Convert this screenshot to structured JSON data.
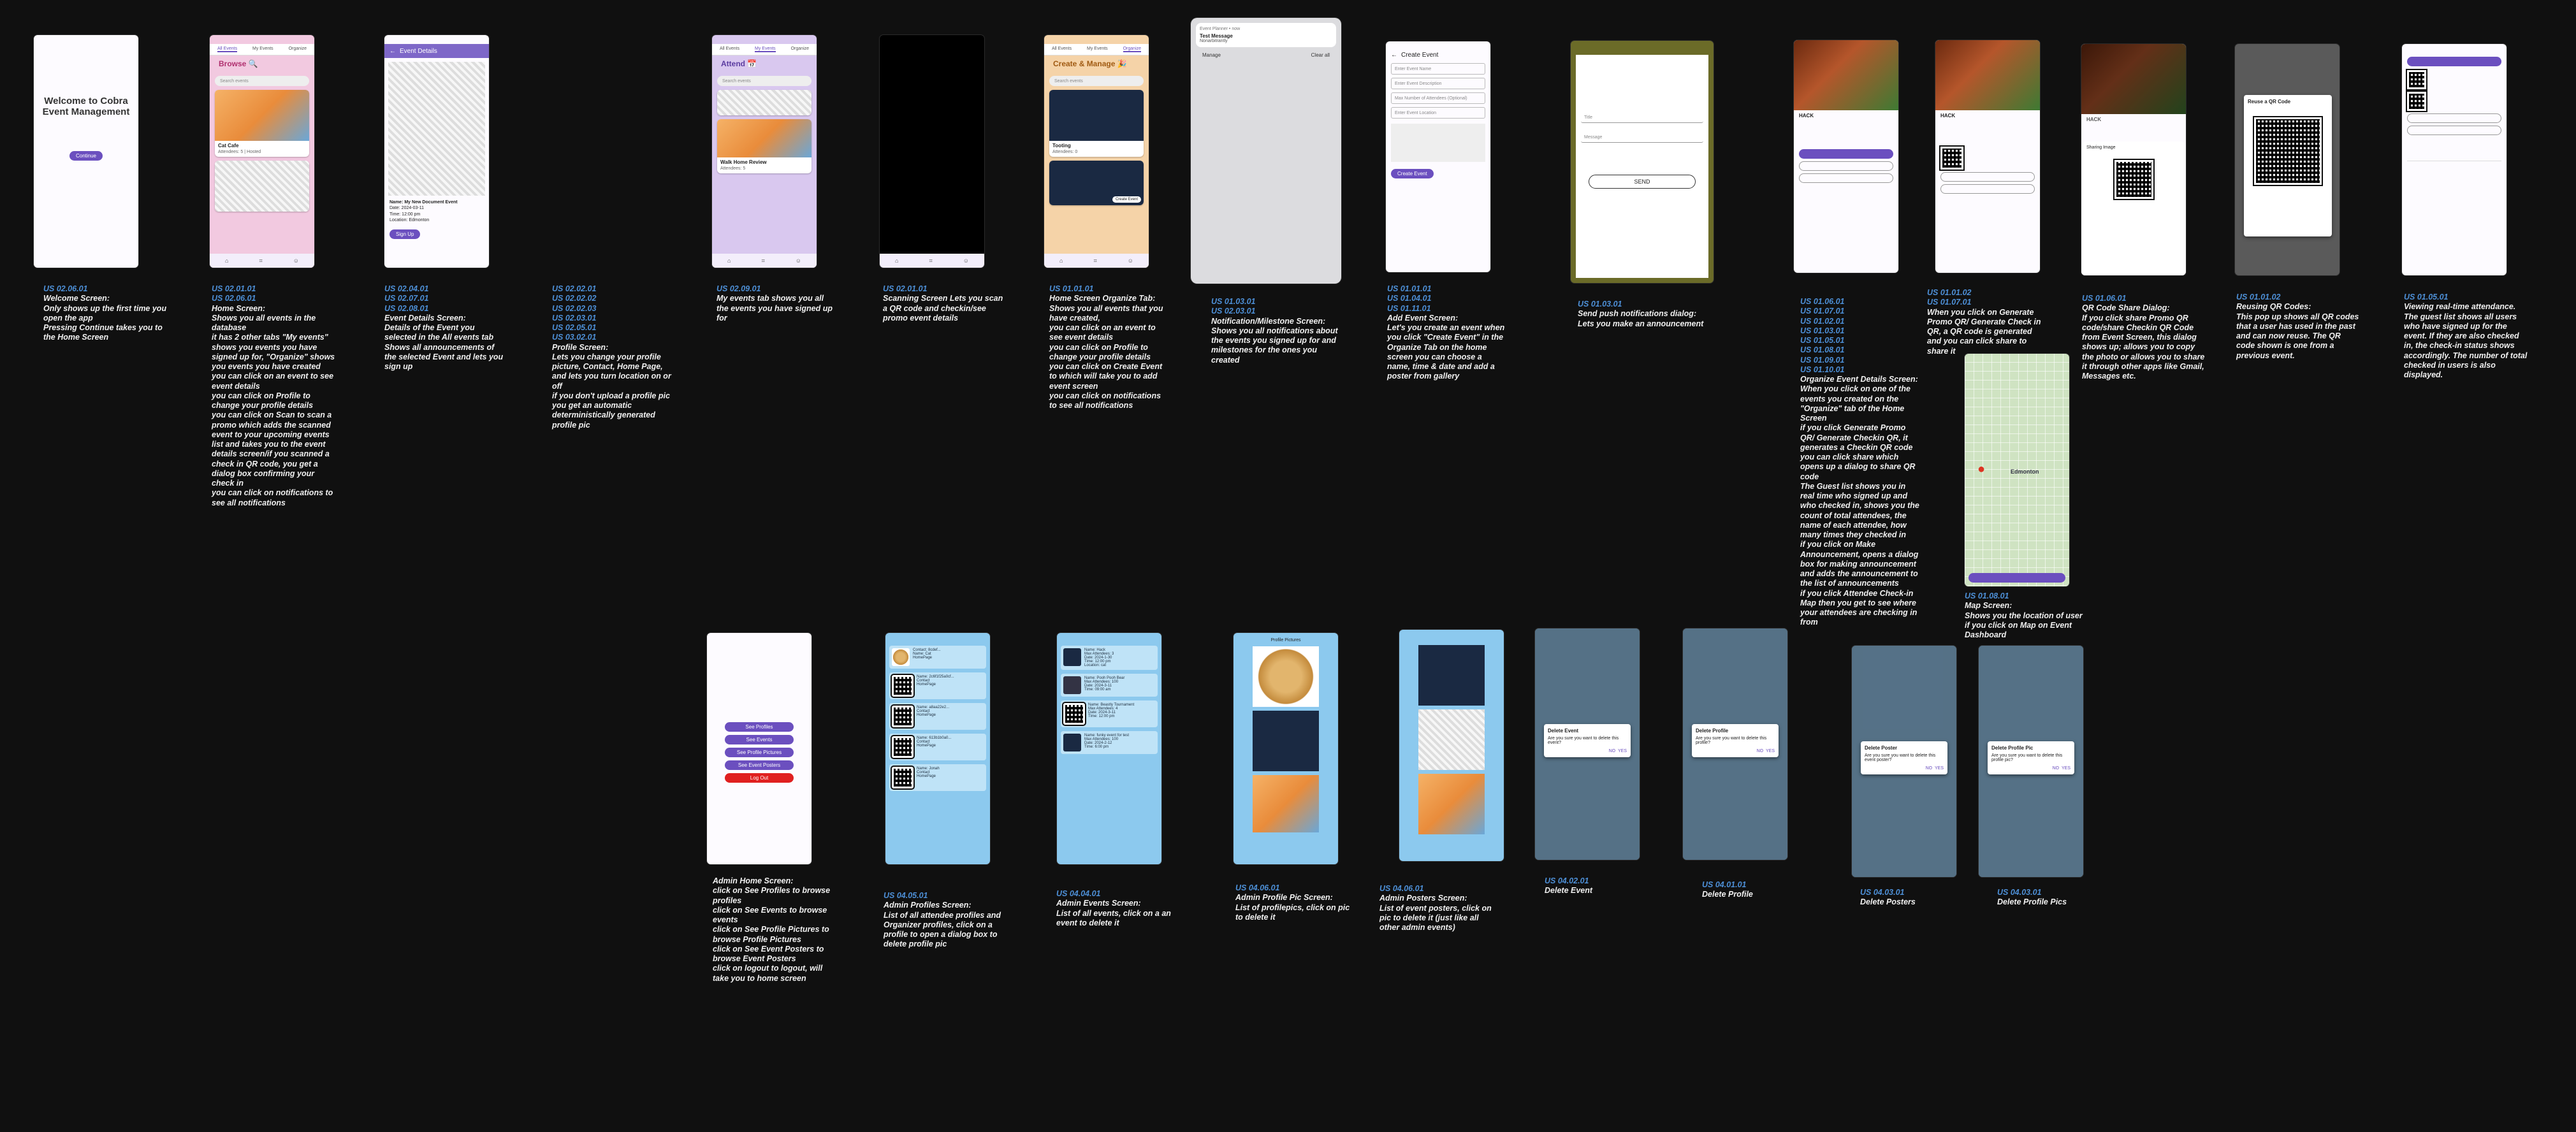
{
  "colors": {
    "accent": "#6b4fbf",
    "caption": "#f0f0f0",
    "us": "#4d8fd6",
    "admin_blue": "#8cc9ee",
    "delete": "#e02020"
  },
  "welcome": {
    "title": "Welcome to Cobra Event Management",
    "continue": "Continue",
    "caption_us": "US 02.06.01",
    "caption": "Welcome Screen:\nOnly shows up the first time you open the app\nPressing Continue takes you to the Home Screen"
  },
  "browse": {
    "tabs": [
      "All Events",
      "My Events",
      "Organize"
    ],
    "title": "Browse 🔍",
    "search": "Search events",
    "cards": [
      {
        "title": "Cat Cafe",
        "meta": "Attendees: 5 | Hosted"
      }
    ],
    "caption_us": "US 02.01.01\nUS 02.06.01",
    "caption": "Home Screen:\nShows you all events in the database\nit has 2 other tabs \"My events\" shows you events you have signed up for, \"Organize\" shows you events you have created\nyou can click on an event to see event details\nyou can click on Profile to change your profile details\nyou can click on Scan to scan a promo which adds the scanned event to your upcoming events list and takes you to the event details screen/if you scanned a check in QR code, you get a dialog box confirming your check in\nyou can click on notifications to see all notifications"
  },
  "details": {
    "appbar": "Event Details",
    "name": "Name: My New Document Event",
    "date": "Date: 2024-03-11",
    "time": "Time: 12:00 pm",
    "location": "Location: Edmonton",
    "signup": "Sign Up",
    "caption_us": "US 02.04.01\nUS 02.07.01\nUS 02.08.01",
    "caption": "Event Details Screen:\nDetails of the Event you selected in the All events tab\nShows all announcements of the selected Event and lets you sign up"
  },
  "profile": {
    "caption_us": "US 02.02.01\nUS 02.02.02\nUS 02.02.03\nUS 02.03.01\nUS 02.05.01\nUS 03.02.01",
    "caption": "Profile Screen:\nLets you change your profile picture, Contact, Home Page, and lets you turn location on or off\nif you don't upload a profile pic you get an automatic deterministically generated profile pic"
  },
  "attend": {
    "title": "Attend 📅",
    "search": "Search events",
    "cards": [
      {
        "title": "Walk Home Review",
        "meta": "Attendees: 5"
      }
    ],
    "caption_us": "US 02.09.01",
    "caption": "My events tab shows you all the events you have signed up for"
  },
  "scan": {
    "caption_us": "US 02.01.01",
    "caption": "Scanning Screen Lets you scan a QR code and checkin/see promo event details"
  },
  "organize": {
    "title": "Create & Manage 🎉",
    "search": "Search events",
    "cards": [
      {
        "title": "Tooting",
        "meta": "Attendees: 0"
      }
    ],
    "create": "Create Event",
    "caption_us": "US 01.01.01",
    "caption": "Home Screen Organize Tab:\nShows you all events that you have created,\nyou can click on an event to see event details\nyou can click on Profile to change your profile details\nyou can click on Create Event to which will take you to add event screen\nyou can click on notifications to see all notifications"
  },
  "notification": {
    "sender": "Event Planner • now",
    "title": "Test Message",
    "body": "Nonarbitrantly",
    "manage": "Manage",
    "clear": "Clear all",
    "caption_us": "US 01.03.01\nUS 02.03.01",
    "caption": "Notification/Milestone Screen:\nShows you all notifications about the events you signed up for and milestones for the ones you created"
  },
  "addevent": {
    "appbar": "Create Event",
    "fields": [
      "Enter Event Name",
      "Enter Event Description",
      "Max Number of Attendees (Optional)",
      "Enter Event Location"
    ],
    "caption_us": "US 01.01.01\nUS 01.04.01\nUS 01.11.01",
    "caption": "Add Event Screen:\nLet's you create an event when you click \"Create Event\" in the Organize Tab on the home screen you can choose a name, time & date and add a poster from gallery"
  },
  "pushdialog": {
    "title": "Title",
    "message": "Message",
    "send": "SEND",
    "caption_us": "US 01.03.01",
    "caption": "Send push notifications dialog:\nLets you make an announcement"
  },
  "orgdetails": {
    "name": "HACK",
    "caption_us": "US 01.06.01\nUS 01.07.01\nUS 01.02.01\nUS 01.03.01\nUS 01.05.01\nUS 01.08.01\nUS 01.09.01\nUS 01.10.01",
    "caption": "Organize Event Details Screen:\nWhen you click on one of the events you created on the \"Organize\" tab of the Home Screen\nif you click Generate Promo QR/ Generate Checkin QR, it generates a Checkin QR code you can click share which opens up a dialog to share QR code\nThe Guest list shows you in real time who signed up and who checked in, shows you the count of total attendees, the name of each attendee, how many times they checked in\nif you click on Make Announcement, opens a dialog box for making announcement and adds the announcement to the list of announcements\nif you click Attendee Check-in Map then you get to see where your attendees are checking in from"
  },
  "genqr": {
    "name": "HACK",
    "caption_us": "US 01.01.02\nUS 01.07.01",
    "caption": "When you click on Generate Promo QR/ Generate Check in QR, a QR code is generated and you can click share to share it"
  },
  "share": {
    "name": "HACK",
    "dialog_title": "Sharing Image",
    "caption_us": "US 01.06.01",
    "caption": "QR Code Share Dialog:\nIf you click share Promo QR code/share Checkin QR Code from Event Screen, this dialog shows up; allows you to copy the photo or allows you to share it through other apps like Gmail, Messages etc."
  },
  "reuse": {
    "dialog_title": "Reuse a QR Code",
    "caption_us": "US 01.01.02",
    "caption": "Reusing QR Codes:\nThis pop up shows all QR codes that a user has used in the past and can now reuse. The QR code shown is one from a previous event."
  },
  "attendance": {
    "caption_us": "US 01.05.01",
    "caption": "Viewing real-time attendance.\nThe guest list shows all users who have signed up for the event. If they are also checked in, the check-in status shows accordingly. The number of total checked in users is also displayed."
  },
  "map": {
    "city": "Edmonton",
    "caption_us": "US 01.08.01",
    "caption": "Map Screen:\nShows you the location of user if you click on Map on Event Dashboard"
  },
  "admin": {
    "buttons": [
      "See Profiles",
      "See Events",
      "See Profile Pictures",
      "See Event Posters",
      "Log Out"
    ],
    "caption": "Admin Home Screen:\nclick on See Profiles to browse profiles\nclick on See Events to browse events\nclick on See Profile Pictures to browse Profile Pictures\nclick on See Event Posters to browse Event Posters\nclick on logout to logout, will take you to home screen"
  },
  "adminprofiles": {
    "rows": [
      "Contact: 8cdef...\nName: Cat\nHomePage",
      "Name: 2c6f1f25a0cf...\nContact\nHomePage",
      "Name: a8aa22e2...\nContact\nHomePage",
      "Name: 613b1b0a0...\nContact\nHomePage",
      "Name: Jonah\nContact\nHomePage"
    ],
    "caption_us": "US 04.05.01",
    "caption": "Admin Profiles Screen:\nList of all attendee profiles and Organizer profiles, click on a profile to open a dialog box to delete profile pic"
  },
  "adminevents": {
    "rows": [
      "Name: Hack\nMax Attendees: 3\nDate: 2024-1-30\nTime: 12:00 pm\nLocation: cat",
      "Name: Pooh Pooh Bear\nMax Attendees: 100\nDate: 2024-3-11\nTime: 09:00 am",
      "Name: Beastly Tournament\nMax Attendees: 4\nDate: 2024-3-11\nTime: 12:00 pm",
      "Name: funky event for test\nMax Attendees: 100\nDate: 2024-2-12\nTime: 6:00 pm"
    ],
    "caption_us": "US 04.04.01",
    "caption": "Admin Events Screen:\nList of all events, click on a an event to delete it"
  },
  "adminpics": {
    "title": "Profile Pictures",
    "caption_us": "US 04.06.01",
    "caption": "Admin Profile Pic Screen:\nList of profilepics, click on pic to delete it"
  },
  "adminposters": {
    "caption_us": "US 04.06.01",
    "caption": "Admin Posters Screen:\nList of event posters, click on pic to delete it (just like all other admin events)"
  },
  "delevent": {
    "title": "Delete Event",
    "body": "Are you sure you want to delete this event?",
    "no": "NO",
    "yes": "YES",
    "caption_us": "US 04.02.01",
    "caption": "Delete Event"
  },
  "delprofile": {
    "title": "Delete Profile",
    "body": "Are you sure you want to delete this profile?",
    "no": "NO",
    "yes": "YES",
    "caption_us": "US 04.01.01",
    "caption": "Delete Profile"
  },
  "delposter": {
    "title": "Delete Poster",
    "body": "Are you sure you want to delete this event poster?",
    "no": "NO",
    "yes": "YES",
    "caption_us": "US 04.03.01",
    "caption": "Delete Posters"
  },
  "delpic": {
    "title": "Delete Profile Pic",
    "body": "Are you sure you want to delete this profile pic?",
    "no": "NO",
    "yes": "YES",
    "caption_us": "US 04.03.01",
    "caption": "Delete Profile Pics"
  }
}
